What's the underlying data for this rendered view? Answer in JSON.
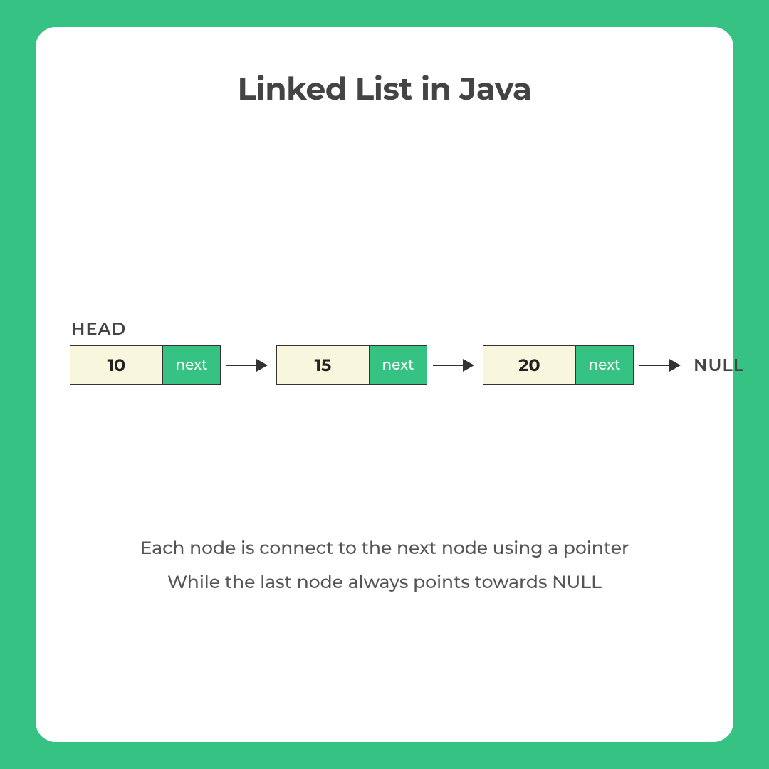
{
  "title": "Linked List in Java",
  "head_label": "HEAD",
  "null_label": "NULL",
  "next_label": "next",
  "nodes": [
    {
      "value": "10"
    },
    {
      "value": "15"
    },
    {
      "value": "20"
    }
  ],
  "caption": {
    "line1": "Each node is connect to the next node using a pointer",
    "line2": "While the last node always points towards NULL"
  },
  "colors": {
    "background": "#35c283",
    "card": "#ffffff",
    "node_value_bg": "#f8f6dc",
    "node_next_bg": "#35c283",
    "text_dark": "#444444"
  }
}
